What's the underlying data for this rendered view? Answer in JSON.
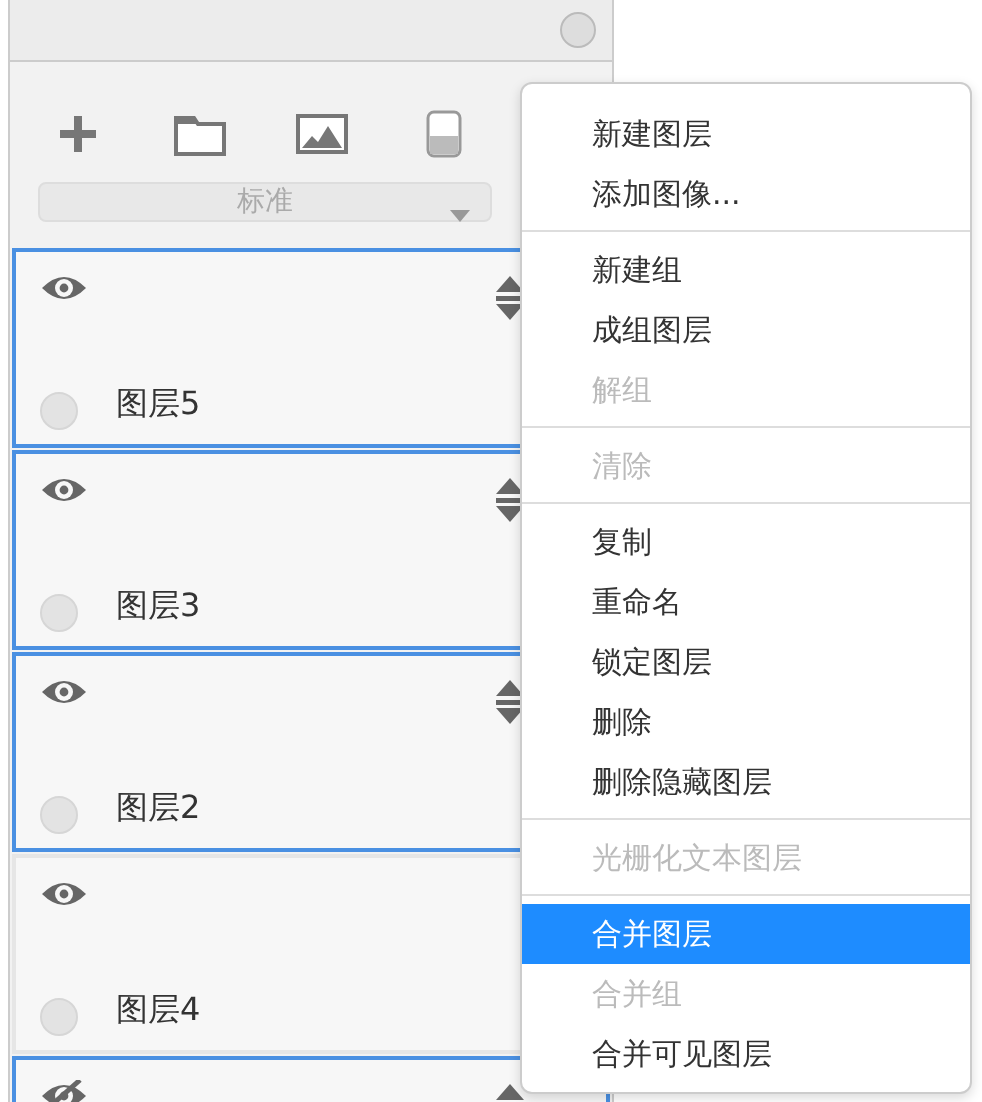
{
  "toolbar": {
    "blend_mode": "标准"
  },
  "layers": [
    {
      "name": "图层5",
      "visible": true,
      "selected": true
    },
    {
      "name": "图层3",
      "visible": true,
      "selected": true
    },
    {
      "name": "图层2",
      "visible": true,
      "selected": true
    },
    {
      "name": "图层4",
      "visible": true,
      "selected": false
    },
    {
      "visible": false,
      "selected": true
    }
  ],
  "context_menu": {
    "items": [
      {
        "kind": "item",
        "label": "新建图层",
        "disabled": false,
        "selected": false
      },
      {
        "kind": "item",
        "label": "添加图像...",
        "disabled": false,
        "selected": false
      },
      {
        "kind": "separator"
      },
      {
        "kind": "item",
        "label": "新建组",
        "disabled": false,
        "selected": false
      },
      {
        "kind": "item",
        "label": "成组图层",
        "disabled": false,
        "selected": false
      },
      {
        "kind": "item",
        "label": "解组",
        "disabled": true,
        "selected": false
      },
      {
        "kind": "separator"
      },
      {
        "kind": "item",
        "label": "清除",
        "disabled": true,
        "selected": false
      },
      {
        "kind": "separator"
      },
      {
        "kind": "item",
        "label": "复制",
        "disabled": false,
        "selected": false
      },
      {
        "kind": "item",
        "label": "重命名",
        "disabled": false,
        "selected": false
      },
      {
        "kind": "item",
        "label": "锁定图层",
        "disabled": false,
        "selected": false
      },
      {
        "kind": "item",
        "label": "删除",
        "disabled": false,
        "selected": false
      },
      {
        "kind": "item",
        "label": "删除隐藏图层",
        "disabled": false,
        "selected": false
      },
      {
        "kind": "separator"
      },
      {
        "kind": "item",
        "label": "光栅化文本图层",
        "disabled": true,
        "selected": false
      },
      {
        "kind": "separator"
      },
      {
        "kind": "item",
        "label": "合并图层",
        "disabled": false,
        "selected": true
      },
      {
        "kind": "item",
        "label": "合并组",
        "disabled": true,
        "selected": false
      },
      {
        "kind": "item",
        "label": "合并可见图层",
        "disabled": false,
        "selected": false
      }
    ]
  }
}
